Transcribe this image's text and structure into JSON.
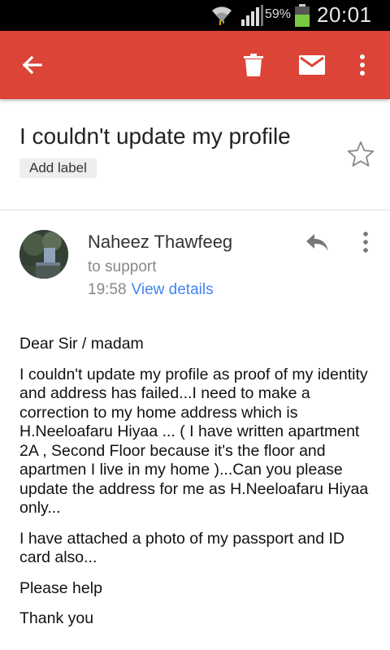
{
  "status_bar": {
    "battery_percent": "59%",
    "time": "20:01",
    "icons": [
      "wifi-icon",
      "signal-icon",
      "battery-icon"
    ]
  },
  "app_bar": {
    "color": "#db4437",
    "icons": [
      "back-arrow-icon",
      "trash-icon",
      "mail-icon",
      "more-vert-icon"
    ]
  },
  "email": {
    "subject": "I couldn't update my profile",
    "label_button": "Add label",
    "sender": {
      "name": "Naheez Thawfeeg",
      "to": "to support",
      "time": "19:58",
      "view_details": "View details"
    },
    "body": {
      "p1": "Dear Sir / madam",
      "p2": "I couldn't update my profile as proof of my identity and address has failed...I need to make a correction to my home address which is H.Neeloafaru Hiyaa ... ( I have written apartment 2A , Second Floor because it's the floor and apartmen I live in my home )...Can you please update the address for me as H.Neeloafaru Hiyaa only...",
      "p3": "I have attached a photo of my passport and ID card also...",
      "p4": "Please help",
      "p5": "Thank you"
    }
  },
  "colors": {
    "accent_red": "#db4437",
    "link_blue": "#4285f4",
    "battery_green": "#7ac943"
  }
}
